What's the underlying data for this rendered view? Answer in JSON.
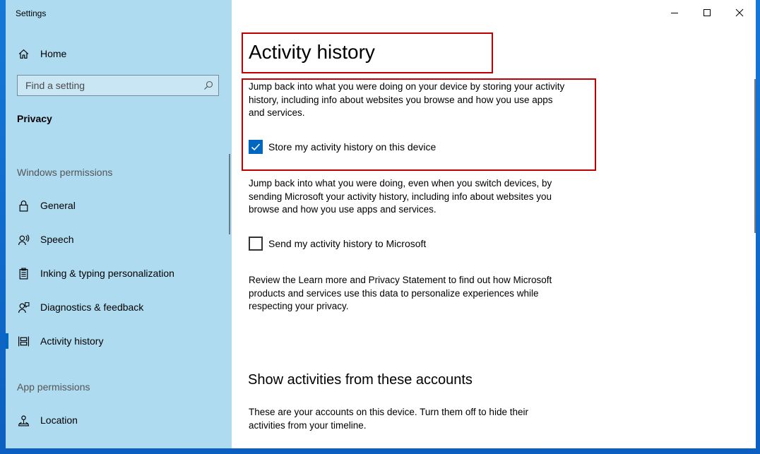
{
  "window": {
    "title": "Settings"
  },
  "sidebar": {
    "home_label": "Home",
    "search_placeholder": "Find a setting",
    "section_label": "Privacy",
    "windows_permissions_heading": "Windows permissions",
    "app_permissions_heading": "App permissions",
    "items": [
      {
        "label": "General",
        "icon": "lock-icon",
        "selected": false
      },
      {
        "label": "Speech",
        "icon": "speech-icon",
        "selected": false
      },
      {
        "label": "Inking & typing personalization",
        "icon": "clipboard-icon",
        "selected": false
      },
      {
        "label": "Diagnostics & feedback",
        "icon": "feedback-icon",
        "selected": false
      },
      {
        "label": "Activity history",
        "icon": "timeline-icon",
        "selected": true
      }
    ],
    "app_items": [
      {
        "label": "Location",
        "icon": "location-icon",
        "selected": false
      }
    ]
  },
  "main": {
    "title": "Activity history",
    "para1": "Jump back into what you were doing on your device by storing your activity history, including info about websites you browse and how you use apps and services.",
    "store_checkbox": {
      "label": "Store my activity history on this device",
      "checked": true
    },
    "para2": "Jump back into what you were doing, even when you switch devices, by sending Microsoft your activity history, including info about websites you browse and how you use apps and services.",
    "send_checkbox": {
      "label": "Send my activity history to Microsoft",
      "checked": false
    },
    "para3": "Review the Learn more and Privacy Statement to find out how Microsoft products and services use this data to personalize experiences while respecting your privacy.",
    "accounts_heading": "Show activities from these accounts",
    "para4": "These are your accounts on this device. Turn them off to hide their activities from your timeline."
  },
  "colors": {
    "sidebar_bg": "#aedbf0",
    "accent": "#0067c0",
    "highlight_border": "#c00000"
  }
}
